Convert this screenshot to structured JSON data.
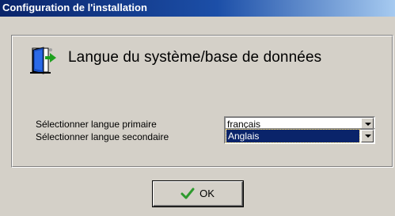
{
  "window": {
    "title": "Configuration de l'installation"
  },
  "section": {
    "heading": "Langue du système/base de données",
    "icon": "door-exit-icon"
  },
  "fields": [
    {
      "label": "Sélectionner langue primaire",
      "value": "français"
    },
    {
      "label": "Sélectionner langue secondaire",
      "value": "Anglais"
    }
  ],
  "buttons": {
    "ok_label": "OK",
    "ok_icon": "checkmark-icon"
  },
  "colors": {
    "titlebar_start": "#0a246a",
    "titlebar_end": "#a6caf0",
    "face": "#d4d0c8",
    "selection": "#0a246a",
    "check": "#2e9a2e"
  }
}
